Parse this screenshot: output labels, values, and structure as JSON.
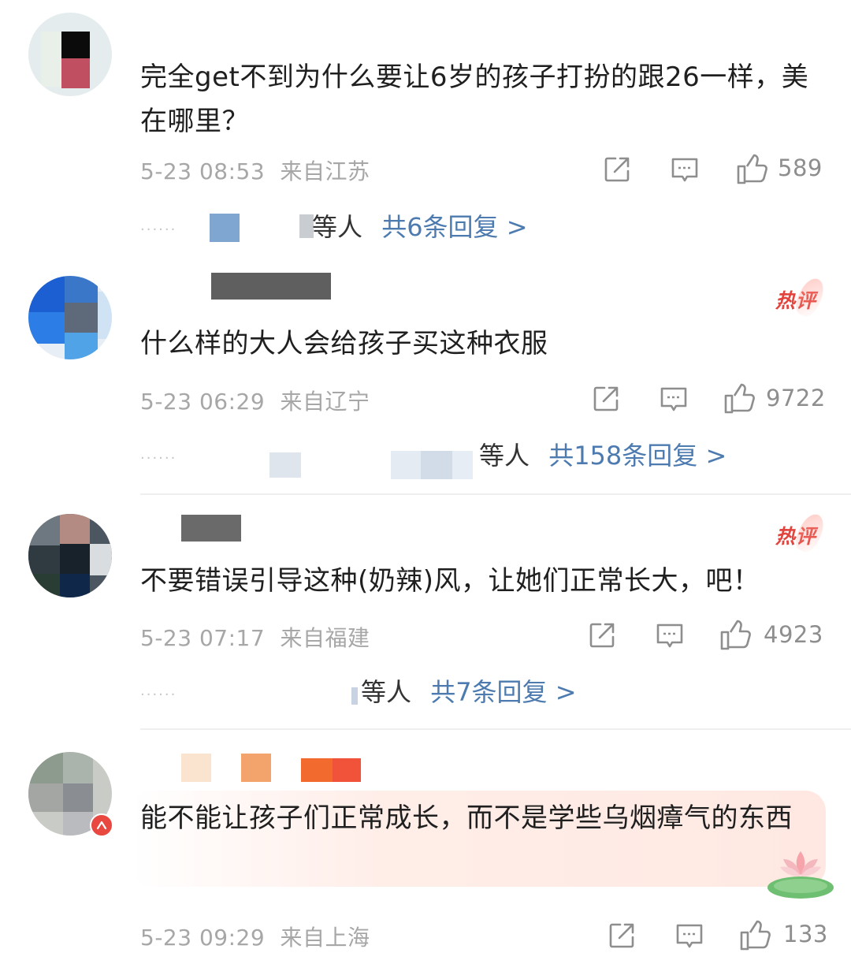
{
  "comments": [
    {
      "text": "完全get不到为什么要让6岁的孩子打扮的跟26一样，美在哪里？",
      "time": "5-23 08:53",
      "location": "来自江苏",
      "likes": "589",
      "hot": false,
      "replies_people": "等人",
      "replies_link": "共6条回复 >"
    },
    {
      "text": "什么样的大人会给孩子买这种衣服",
      "time": "5-23 06:29",
      "location": "来自辽宁",
      "likes": "9722",
      "hot": true,
      "hot_label": "热评",
      "replies_people": "等人",
      "replies_link": "共158条回复 >"
    },
    {
      "text": "不要错误引导这种(奶辣)风，让她们正常长大，吧！",
      "time": "5-23 07:17",
      "location": "来自福建",
      "likes": "4923",
      "hot": true,
      "hot_label": "热评",
      "replies_people": "等人",
      "replies_link": "共7条回复 >"
    },
    {
      "text": "能不能让孩子们正常成长，而不是学些乌烟瘴气的东西",
      "time": "5-23 09:29",
      "location": "来自上海",
      "likes": "133",
      "hot": false
    }
  ],
  "icons": {
    "share": "share-icon",
    "comment": "comment-icon",
    "like": "thumbs-up-icon",
    "verified": "verified-badge-icon",
    "lotus": "lotus-icon"
  },
  "colors": {
    "link": "#4d7bb0",
    "hot": "#e2443d",
    "meta": "#a7a7a7",
    "text": "#1f1f1f"
  }
}
